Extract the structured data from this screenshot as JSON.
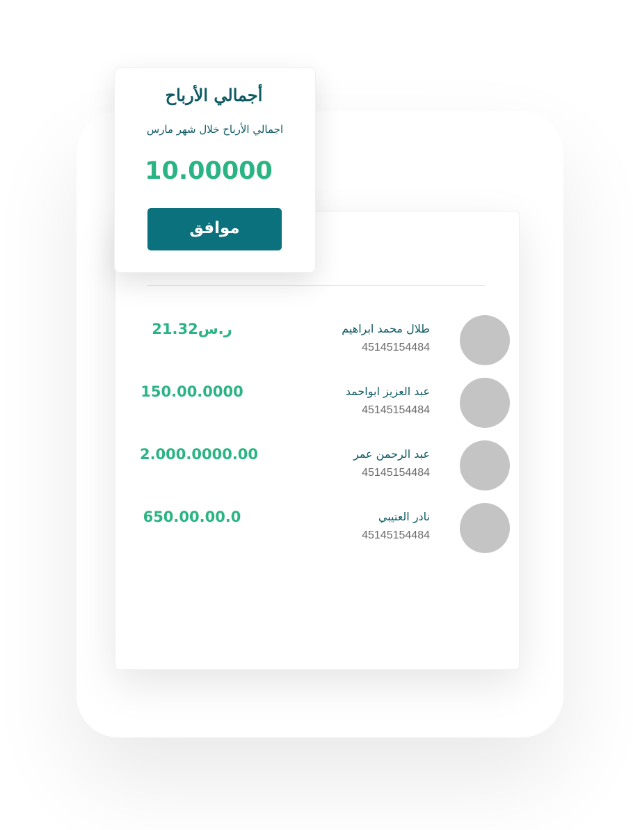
{
  "popup": {
    "title": "أجمالي الأرباح",
    "subtitle": "اجمالي الأرباح خلال شهر مارس",
    "total": "10.00000",
    "ok_label": "موافق"
  },
  "list": {
    "items": [
      {
        "name": "طلال محمد ابراهيم",
        "phone": "45145154484",
        "amount": "21.32",
        "currency": "ر.س"
      },
      {
        "name": "عبد العزيز ابواحمد",
        "phone": "45145154484",
        "amount": "150.00.0000",
        "currency": ""
      },
      {
        "name": "عبد الرحمن عمر",
        "phone": "45145154484",
        "amount": "2.000.0000.00",
        "currency": ""
      },
      {
        "name": "نادر العتيبي",
        "phone": "45145154484",
        "amount": "650.00.00.0",
        "currency": ""
      }
    ]
  },
  "colors": {
    "primary": "#0b717c",
    "text_dark": "#0d5a63",
    "amount_green": "#2bb483",
    "avatar_gray": "#c4c4c4"
  }
}
